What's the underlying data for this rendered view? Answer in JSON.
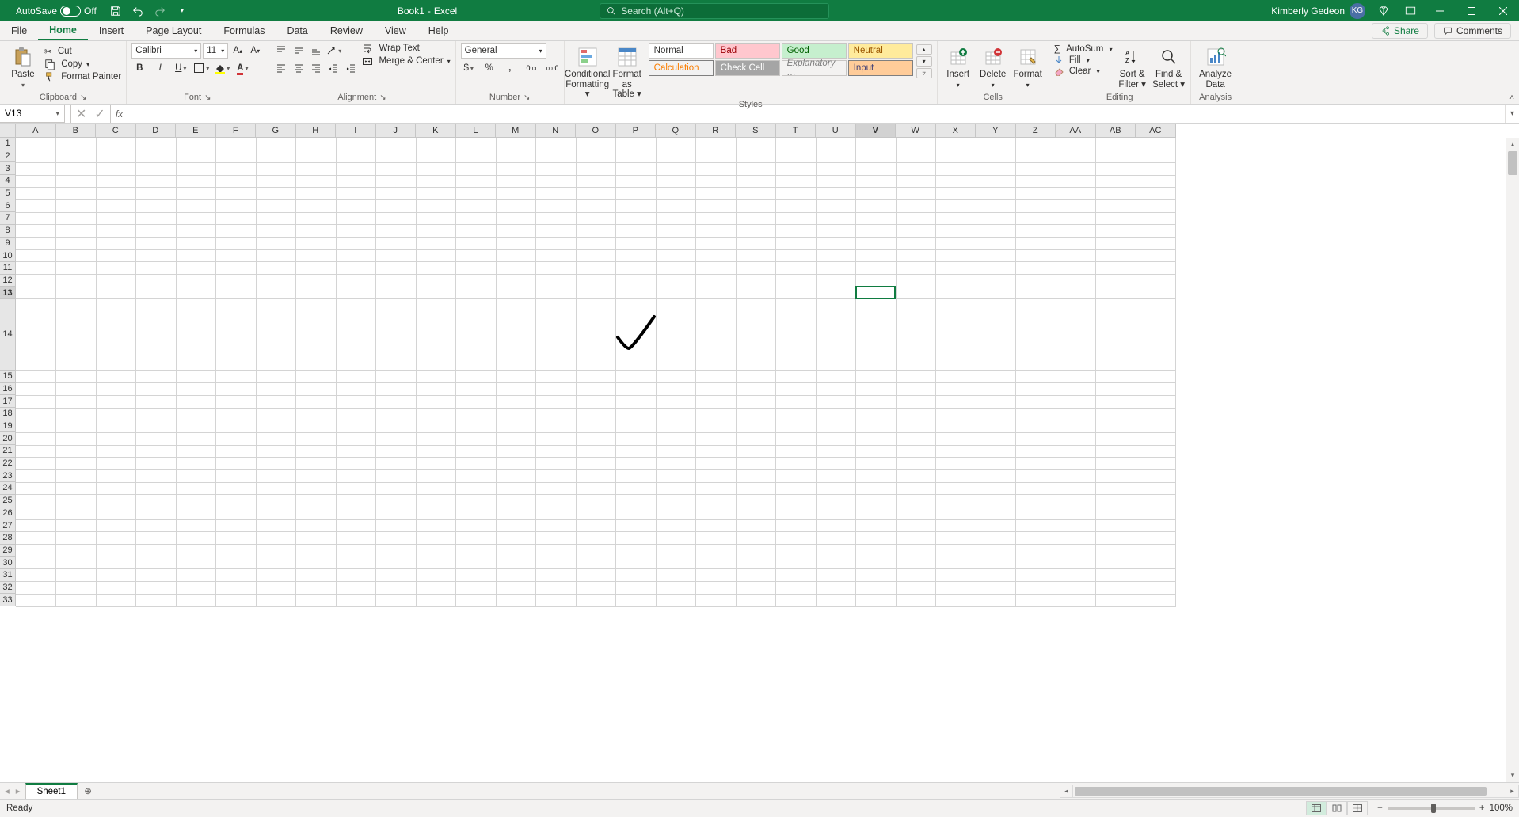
{
  "titlebar": {
    "autosave_label": "AutoSave",
    "autosave_state": "Off",
    "doc_name": "Book1",
    "doc_app_sep": "-",
    "app_name": "Excel",
    "search_placeholder": "Search (Alt+Q)",
    "user_name": "Kimberly Gedeon",
    "user_initials": "KG"
  },
  "tabs": {
    "file": "File",
    "home": "Home",
    "insert": "Insert",
    "page_layout": "Page Layout",
    "formulas": "Formulas",
    "data": "Data",
    "review": "Review",
    "view": "View",
    "help": "Help",
    "share": "Share",
    "comments": "Comments"
  },
  "ribbon": {
    "clipboard": {
      "paste": "Paste",
      "cut": "Cut",
      "copy": "Copy",
      "format_painter": "Format Painter",
      "label": "Clipboard"
    },
    "font": {
      "name": "Calibri",
      "size": "11",
      "label": "Font"
    },
    "alignment": {
      "wrap_text": "Wrap Text",
      "merge_center": "Merge & Center",
      "label": "Alignment"
    },
    "number": {
      "format": "General",
      "label": "Number"
    },
    "styles": {
      "cond_fmt_l1": "Conditional",
      "cond_fmt_l2": "Formatting",
      "fmt_table_l1": "Format as",
      "fmt_table_l2": "Table",
      "normal": "Normal",
      "bad": "Bad",
      "good": "Good",
      "neutral": "Neutral",
      "calculation": "Calculation",
      "check_cell": "Check Cell",
      "explanatory": "Explanatory …",
      "input": "Input",
      "label": "Styles"
    },
    "cells": {
      "insert": "Insert",
      "delete": "Delete",
      "format": "Format",
      "label": "Cells"
    },
    "editing": {
      "autosum": "AutoSum",
      "fill": "Fill",
      "clear": "Clear",
      "sort_filter_l1": "Sort &",
      "sort_filter_l2": "Filter",
      "find_select_l1": "Find &",
      "find_select_l2": "Select",
      "label": "Editing"
    },
    "analysis": {
      "analyze_l1": "Analyze",
      "analyze_l2": "Data",
      "label": "Analysis"
    }
  },
  "namebar": {
    "cell_ref": "V13",
    "fx": "fx",
    "formula_value": ""
  },
  "grid": {
    "columns": [
      "A",
      "B",
      "C",
      "D",
      "E",
      "F",
      "G",
      "H",
      "I",
      "J",
      "K",
      "L",
      "M",
      "N",
      "O",
      "P",
      "Q",
      "R",
      "S",
      "T",
      "U",
      "V",
      "W",
      "X",
      "Y",
      "Z",
      "AA",
      "AB",
      "AC"
    ],
    "rows": [
      1,
      2,
      3,
      4,
      5,
      6,
      7,
      8,
      9,
      10,
      11,
      12,
      13,
      14,
      15,
      16,
      17,
      18,
      19,
      20,
      21,
      22,
      23,
      24,
      25,
      26,
      27,
      28,
      29,
      30,
      31,
      32,
      33
    ],
    "tall_row": 14,
    "active_col": "V",
    "active_row": 13,
    "checkmark_cell": "P14"
  },
  "sheetbar": {
    "sheet1": "Sheet1"
  },
  "statusbar": {
    "ready": "Ready",
    "zoom": "100%"
  },
  "colors": {
    "excel_green": "#107c41",
    "bad_bg": "#ffc7ce",
    "good_bg": "#c6efce",
    "neutral_bg": "#ffeb9c",
    "calc_bg": "#f2f2f2",
    "calc_fg": "#fa7d00",
    "check_bg": "#a5a5a5",
    "input_bg": "#ffcc99"
  }
}
